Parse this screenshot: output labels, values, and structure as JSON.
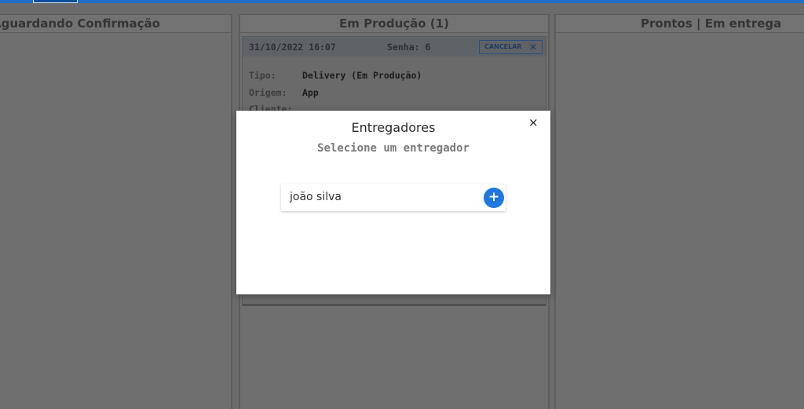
{
  "columns": {
    "awaiting": {
      "title": "Aguardando Confirmação"
    },
    "production": {
      "title": "Em Produção (1)"
    },
    "ready": {
      "title": "Prontos | Em entrega"
    }
  },
  "order_card": {
    "datetime": "31/10/2022 16:07",
    "senha_label": "Senha:",
    "senha_value": "6",
    "cancel_label": "CANCELAR",
    "cancel_icon": "close-icon",
    "rows": [
      {
        "label": "Tipo:",
        "value": "Delivery (Em Produção)"
      },
      {
        "label": "Origem:",
        "value": "App"
      },
      {
        "label": "Cliente:",
        "value": ""
      }
    ]
  },
  "modal": {
    "title": "Entregadores",
    "subtitle": "Selecione um entregador",
    "close_symbol": "×",
    "drivers": [
      {
        "name": "joão silva",
        "add_symbol": "+"
      }
    ]
  },
  "colors": {
    "accent": "#1e78e0",
    "top_bar": "#1e6fc7",
    "overlay": "#6b6b6b"
  }
}
